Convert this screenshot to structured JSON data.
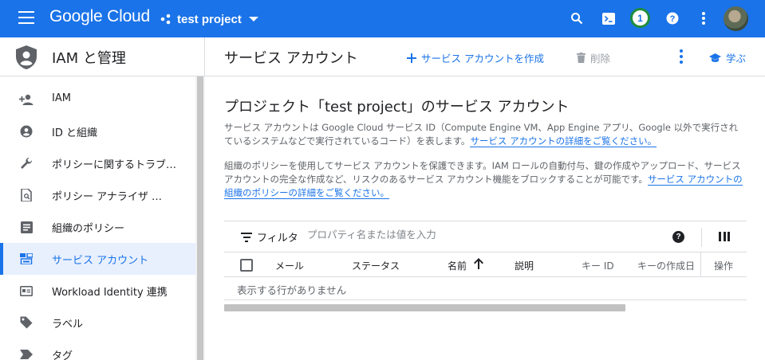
{
  "topbar": {
    "brand": "Google Cloud",
    "project_name": "test project",
    "notification_count": "1"
  },
  "sidebar": {
    "title": "IAM と管理",
    "items": [
      {
        "label": "IAM",
        "icon": "person-add-icon"
      },
      {
        "label": "ID と組織",
        "icon": "account-circle-icon"
      },
      {
        "label": "ポリシーに関するトラブ…",
        "icon": "wrench-icon"
      },
      {
        "label": "ポリシー アナライザ …",
        "icon": "document-search-icon"
      },
      {
        "label": "組織のポリシー",
        "icon": "list-document-icon"
      },
      {
        "label": "サービス アカウント",
        "icon": "service-account-icon",
        "active": true
      },
      {
        "label": "Workload Identity 連携",
        "icon": "id-card-icon"
      },
      {
        "label": "ラベル",
        "icon": "label-icon"
      },
      {
        "label": "タグ",
        "icon": "tag-icon"
      }
    ]
  },
  "main": {
    "title": "サービス アカウント",
    "create_label": "サービス アカウントを作成",
    "delete_label": "削除",
    "learn_label": "学ぶ"
  },
  "content": {
    "heading": "プロジェクト「test project」のサービス アカウント",
    "p1_text": "サービス アカウントは Google Cloud サービス ID（Compute Engine VM、App Engine アプリ、Google 以外で実行されているシステムなどで実行されているコード）を表します。",
    "p1_link": "サービス アカウントの詳細をご覧ください。",
    "p2_text": "組織のポリシーを使用してサービス アカウントを保護できます。IAM ロールの自動付与、鍵の作成やアップロード、サービス アカウントの完全な作成など、リスクのあるサービス アカウント機能をブロックすることが可能です。",
    "p2_link": "サービス アカウントの組織のポリシーの詳細をご覧ください。"
  },
  "table": {
    "filter_label": "フィルタ",
    "filter_placeholder": "プロパティ名または値を入力",
    "columns": [
      "メール",
      "ステータス",
      "名前",
      "説明",
      "キー ID",
      "キーの作成日",
      "操作"
    ],
    "empty_text": "表示する行がありません"
  },
  "colors": {
    "topbar": "#1a73e8",
    "accent": "#1a73e8",
    "active_bg": "#e8f0fe",
    "badge_ring": "#1e8e3e"
  }
}
